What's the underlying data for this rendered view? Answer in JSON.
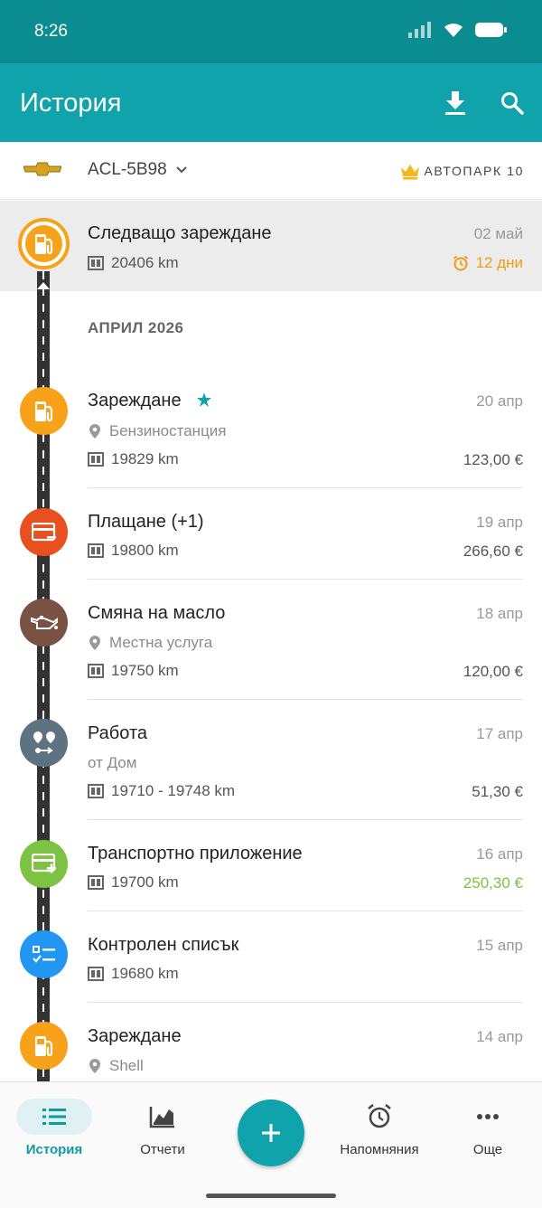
{
  "status_bar": {
    "time": "8:26"
  },
  "app_bar": {
    "title": "История"
  },
  "vehicle": {
    "name": "ACL-5B98",
    "fleet_label": "АВТОПАРК 10"
  },
  "next_refuel": {
    "title": "Следващо зареждане",
    "date": "02 май",
    "odometer": "20406 km",
    "countdown": "12 дни"
  },
  "section": {
    "label": "АПРИЛ 2026"
  },
  "entries": [
    {
      "title": "Зареждане",
      "date": "20 апр",
      "place": "Бензиностанция",
      "odometer": "19829 km",
      "amount": "123,00 €"
    },
    {
      "title": "Плащане (+1)",
      "date": "19 апр",
      "odometer": "19800 km",
      "amount": "266,60 €"
    },
    {
      "title": "Смяна на масло",
      "date": "18 апр",
      "place": "Местна услуга",
      "odometer": "19750 km",
      "amount": "120,00 €"
    },
    {
      "title": "Работа",
      "date": "17 апр",
      "origin": "от Дом",
      "odometer": "19710 - 19748 km",
      "amount": "51,30 €"
    },
    {
      "title": "Транспортно приложение",
      "date": "16 апр",
      "odometer": "19700 km",
      "amount": "250,30 €"
    },
    {
      "title": "Контролен списък",
      "date": "15 апр",
      "odometer": "19680 km"
    },
    {
      "title": "Зареждане",
      "date": "14 апр",
      "place": "Shell"
    }
  ],
  "colors": {
    "fuel": "#f7a21a",
    "expense": "#e9501f",
    "service": "#7a5244",
    "route": "#5d7381",
    "income": "#7dc242",
    "checklist": "#2196f3",
    "accent": "#10a3ab"
  },
  "bottom_nav": {
    "history": "История",
    "reports": "Отчети",
    "reminders": "Напомняния",
    "more": "Още"
  }
}
